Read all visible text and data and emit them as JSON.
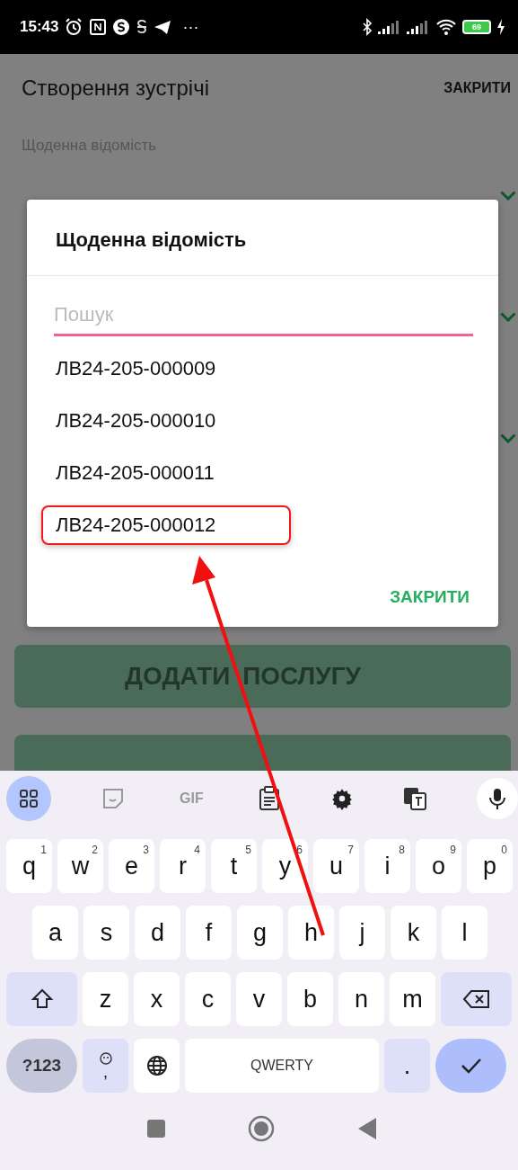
{
  "status_bar": {
    "time": "15:43",
    "more": "···",
    "battery": "69"
  },
  "screen": {
    "title": "Створення зустрічі",
    "close": "ЗАКРИТИ",
    "field_label": "Щоденна відомість",
    "buttons": [
      {
        "label": "ДОДАТИ ПОСЛУГУ"
      }
    ]
  },
  "dialog": {
    "title": "Щоденна відомість",
    "search": {
      "placeholder": "Пошук"
    },
    "items": [
      {
        "label": "ЛВ24-205-000009",
        "highlighted": false
      },
      {
        "label": "ЛВ24-205-000010",
        "highlighted": false
      },
      {
        "label": "ЛВ24-205-000011",
        "highlighted": false
      },
      {
        "label": "ЛВ24-205-000012",
        "highlighted": true
      }
    ],
    "close": "ЗАКРИТИ"
  },
  "keyboard": {
    "toolbar": [
      "GIF"
    ],
    "rows": [
      [
        {
          "kind": "letter",
          "label": "q",
          "hint": "1"
        },
        {
          "kind": "letter",
          "label": "w",
          "hint": "2"
        },
        {
          "kind": "letter",
          "label": "e",
          "hint": "3"
        },
        {
          "kind": "letter",
          "label": "r",
          "hint": "4"
        },
        {
          "kind": "letter",
          "label": "t",
          "hint": "5"
        },
        {
          "kind": "letter",
          "label": "y",
          "hint": "6"
        },
        {
          "kind": "letter",
          "label": "u",
          "hint": "7"
        },
        {
          "kind": "letter",
          "label": "i",
          "hint": "8"
        },
        {
          "kind": "letter",
          "label": "o",
          "hint": "9"
        },
        {
          "kind": "letter",
          "label": "p",
          "hint": "0"
        }
      ],
      [
        {
          "kind": "letter",
          "label": "a"
        },
        {
          "kind": "letter",
          "label": "s"
        },
        {
          "kind": "letter",
          "label": "d"
        },
        {
          "kind": "letter",
          "label": "f"
        },
        {
          "kind": "letter",
          "label": "g"
        },
        {
          "kind": "letter",
          "label": "h"
        },
        {
          "kind": "letter",
          "label": "j"
        },
        {
          "kind": "letter",
          "label": "k"
        },
        {
          "kind": "letter",
          "label": "l"
        }
      ],
      [
        {
          "kind": "shift"
        },
        {
          "kind": "letter",
          "label": "z"
        },
        {
          "kind": "letter",
          "label": "x"
        },
        {
          "kind": "letter",
          "label": "c"
        },
        {
          "kind": "letter",
          "label": "v"
        },
        {
          "kind": "letter",
          "label": "b"
        },
        {
          "kind": "letter",
          "label": "n"
        },
        {
          "kind": "letter",
          "label": "m"
        },
        {
          "kind": "backspace"
        }
      ]
    ],
    "bottom_row": [
      {
        "kind": "symbols",
        "label": "?123"
      },
      {
        "kind": "emoji",
        "label": ","
      },
      {
        "kind": "globe"
      },
      {
        "kind": "space",
        "label": "QWERTY"
      },
      {
        "kind": "period",
        "label": "."
      },
      {
        "kind": "enter"
      }
    ]
  }
}
